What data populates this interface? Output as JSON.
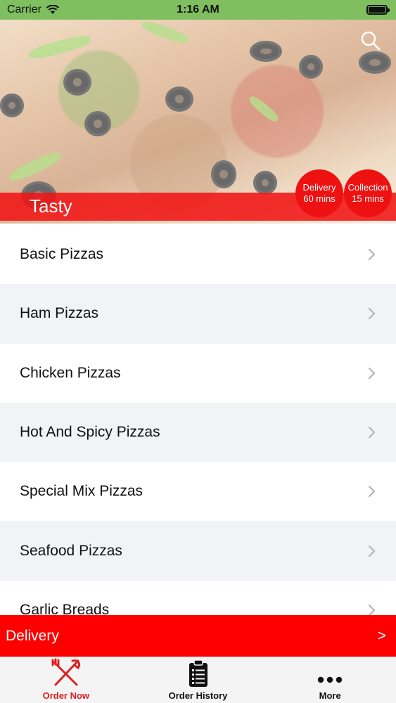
{
  "status_bar": {
    "carrier": "Carrier",
    "time": "1:16 AM"
  },
  "hero": {
    "restaurant_name": "Tasty",
    "delivery_badge": {
      "label": "Delivery",
      "time": "60 mins"
    },
    "collection_badge": {
      "label": "Collection",
      "time": "15 mins"
    },
    "search_icon": "search-icon"
  },
  "categories": [
    {
      "label": "Basic Pizzas"
    },
    {
      "label": "Ham Pizzas"
    },
    {
      "label": "Chicken Pizzas"
    },
    {
      "label": "Hot And Spicy Pizzas"
    },
    {
      "label": "Special Mix Pizzas"
    },
    {
      "label": "Seafood Pizzas"
    },
    {
      "label": "Garlic Breads"
    }
  ],
  "delivery_bar": {
    "label": "Delivery",
    "arrow": ">"
  },
  "tab_bar": {
    "tabs": [
      {
        "label": "Order Now",
        "icon": "fork-knife-icon",
        "active": true
      },
      {
        "label": "Order History",
        "icon": "clipboard-list-icon",
        "active": false
      },
      {
        "label": "More",
        "icon": "more-dots-icon",
        "active": false
      }
    ]
  },
  "colors": {
    "accent": "#ff0000",
    "status_bar": "#7fbf5f",
    "row_alt": "#f1f3f6"
  }
}
